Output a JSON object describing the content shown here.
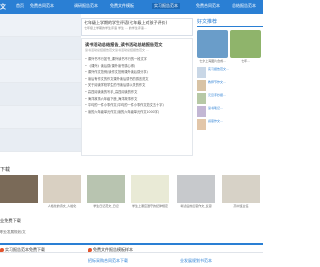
{
  "nav": {
    "logo": "文",
    "items": [
      "首页",
      "免费合同范本",
      "调研报告范本",
      "免费文件模板",
      "实习报告范本",
      "免费合同范本",
      "总结报告范本"
    ]
  },
  "feature": {
    "head_title": "七年级上学期的学生评语(七年级上对孩子评价)",
    "head_sub": "七年级上学期的学生评语 学生 ... 的学生评语...",
    "card_title": "读书活动总结报告_读书活动总结报告范文",
    "card_sub": "读书活动总结报告范文读书活动总结报告范文 ...",
    "list": [
      "课外书不行如书_课外读书不行的一段文字",
      "《课外》读后感(课外读书感心得)",
      "课外作文范例(读作文范例课外读后感分享)",
      "读后有作文的作文课外读后感书的感言范文",
      "关于阅读学校学生的书读后感以关的作文",
      "高四阅读读的写手_高四阅读的作文",
      "海洋故事六年级下册_海洋故事作文",
      "平均的一件小事作文(平均的一件小事作文范文五十字)",
      "读的六年级单元作文(读的六年级单元作文1000字)"
    ]
  },
  "right": {
    "section_title": "好文推荐",
    "thumbs": [
      {
        "caption": "七夕上海图片合成...",
        "color": "#6a9dc9"
      },
      {
        "caption": "七年...",
        "color": "#8fb46b"
      }
    ],
    "list": [
      "实习报告范文...",
      "教师节作文...",
      "元旦手抄报...",
      "读书笔记...",
      "感恩作文..."
    ]
  },
  "section2": {
    "title": "下载",
    "items": [
      {
        "caption": "",
        "color": "#7a6a58"
      },
      {
        "caption": "人格化的诗文_人格化",
        "color": "#d9d0c2"
      },
      {
        "caption": "学生日记范文_日记",
        "color": "#b8c4b0"
      },
      {
        "caption": "学生上课应遵守的纪律规定",
        "color": "#e9ead6"
      },
      {
        "caption": "考试后的反思作文_反思",
        "color": "#c7c9cc"
      },
      {
        "caption": "高中班主任",
        "color": "#d7d2c7"
      }
    ]
  },
  "block2": {
    "title": "业免费下载",
    "sub": "职业发展规划/文"
  },
  "bottombar": {
    "items": [
      "实习报告范本免费下载",
      "免费文件报告模板样本"
    ]
  },
  "bottom": {
    "text": "招标采购合同范本下载",
    "text2": "业发展规划书范本"
  }
}
